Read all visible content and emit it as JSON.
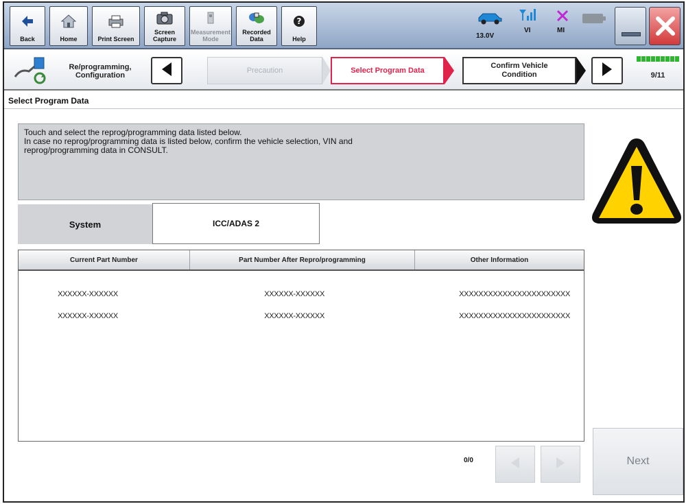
{
  "toolbar": {
    "back": "Back",
    "home": "Home",
    "print_screen": "Print Screen",
    "screen_capture": "Screen\nCapture",
    "measurement_mode": "Measurement\nMode",
    "recorded_data": "Recorded\nData",
    "help": "Help",
    "voltage": "13.0V",
    "vi": "VI",
    "mi": "MI"
  },
  "breadcrumb": {
    "title": "Re/programming,\nConfiguration",
    "previous_step": "Precaution",
    "current_step": "Select Program Data",
    "next_step": "Confirm Vehicle\nCondition",
    "progress": "9/11"
  },
  "page": {
    "title": "Select Program Data",
    "message": "Touch and select the reprog/programming data listed below.\nIn case no reprog/programming data is listed below, confirm the vehicle selection, VIN and\nreprog/programming data in CONSULT."
  },
  "system": {
    "label": "System",
    "value": "ICC/ADAS 2"
  },
  "table": {
    "columns": [
      "Current Part Number",
      "Part Number After Repro/programming",
      "Other Information"
    ],
    "rows": [
      [
        "XXXXXX-XXXXXX",
        "XXXXXX-XXXXXX",
        "XXXXXXXXXXXXXXXXXXXXXXX"
      ],
      [
        "XXXXXX-XXXXXX",
        "XXXXXX-XXXXXX",
        "XXXXXXXXXXXXXXXXXXXXXXX"
      ]
    ]
  },
  "pager": {
    "count": "0/0"
  },
  "next_button": "Next",
  "colors": {
    "accent": "#e0234b",
    "panel": "#d1d3d6",
    "progress": "#2fb52f"
  }
}
